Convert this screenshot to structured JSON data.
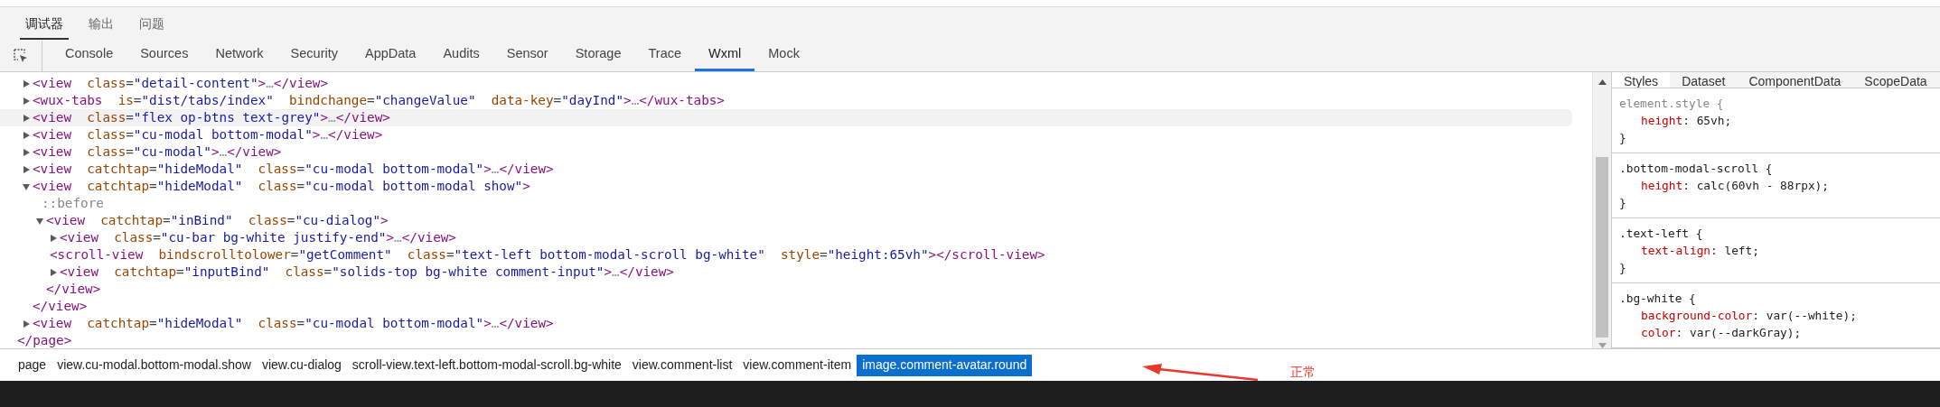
{
  "panel_tabs": [
    {
      "label": "调试器",
      "selected": true
    },
    {
      "label": "输出",
      "selected": false
    },
    {
      "label": "问题",
      "selected": false
    }
  ],
  "tool_tabs": [
    {
      "label": "Console",
      "selected": false
    },
    {
      "label": "Sources",
      "selected": false
    },
    {
      "label": "Network",
      "selected": false
    },
    {
      "label": "Security",
      "selected": false
    },
    {
      "label": "AppData",
      "selected": false
    },
    {
      "label": "Audits",
      "selected": false
    },
    {
      "label": "Sensor",
      "selected": false
    },
    {
      "label": "Storage",
      "selected": false
    },
    {
      "label": "Trace",
      "selected": false
    },
    {
      "label": "Wxml",
      "selected": true
    },
    {
      "label": "Mock",
      "selected": false
    }
  ],
  "tree": {
    "nodes": [
      {
        "kind": "element",
        "expanded": false,
        "highlighted": false,
        "open": "<view",
        "attrs": [
          "class=\"detail-content\""
        ],
        "close": ">",
        "collapsed_text": "…",
        "end": "</view>"
      },
      {
        "kind": "element",
        "expanded": false,
        "highlighted": false,
        "open": "<wux-tabs",
        "attrs": [
          "is=\"dist/tabs/index\"",
          "bindchange=\"changeValue\"",
          "data-key=\"dayInd\""
        ],
        "close": ">",
        "collapsed_text": "…",
        "end": "</wux-tabs>"
      },
      {
        "kind": "element",
        "expanded": false,
        "highlighted": true,
        "open": "<view",
        "attrs": [
          "class=\"flex op-btns text-grey\""
        ],
        "close": ">",
        "collapsed_text": "…",
        "end": "</view>"
      },
      {
        "kind": "element",
        "expanded": false,
        "highlighted": false,
        "open": "<view",
        "attrs": [
          "class=\"cu-modal bottom-modal\""
        ],
        "close": ">",
        "collapsed_text": "…",
        "end": "</view>"
      },
      {
        "kind": "element",
        "expanded": false,
        "highlighted": false,
        "open": "<view",
        "attrs": [
          "class=\"cu-modal\""
        ],
        "close": ">",
        "collapsed_text": "…",
        "end": "</view>"
      },
      {
        "kind": "element",
        "expanded": false,
        "highlighted": false,
        "open": "<view",
        "attrs": [
          "catchtap=\"hideModal\"",
          "class=\"cu-modal bottom-modal\""
        ],
        "close": ">",
        "collapsed_text": "…",
        "end": "</view>"
      },
      {
        "kind": "element",
        "expanded": true,
        "highlighted": false,
        "open": "<view",
        "attrs": [
          "catchtap=\"hideModal\"",
          "class=\"cu-modal bottom-modal show\""
        ],
        "close": ">",
        "end": "</view>",
        "children": [
          {
            "kind": "pseudo",
            "highlighted": false,
            "text": "::before"
          },
          {
            "kind": "element",
            "expanded": true,
            "highlighted": false,
            "open": "<view",
            "attrs": [
              "catchtap=\"inBind\"",
              "class=\"cu-dialog\""
            ],
            "close": ">",
            "end": "</view>",
            "children": [
              {
                "kind": "element",
                "expanded": false,
                "highlighted": false,
                "open": "<view",
                "attrs": [
                  "class=\"cu-bar bg-white justify-end\""
                ],
                "close": ">",
                "collapsed_text": "…",
                "end": "</view>"
              },
              {
                "kind": "leaf",
                "highlighted": false,
                "open": "<scroll-view",
                "attrs": [
                  "bindscrolltolower=\"getComment\"",
                  "class=\"text-left bottom-modal-scroll bg-white\"",
                  "style=\"height:65vh\""
                ],
                "close": ">",
                "end": "</scroll-view>"
              },
              {
                "kind": "element",
                "expanded": false,
                "highlighted": false,
                "open": "<view",
                "attrs": [
                  "catchtap=\"inputBind\"",
                  "class=\"solids-top bg-white comment-input\""
                ],
                "close": ">",
                "collapsed_text": "…",
                "end": "</view>"
              }
            ]
          }
        ]
      },
      {
        "kind": "element",
        "expanded": false,
        "highlighted": false,
        "open": "<view",
        "attrs": [
          "catchtap=\"hideModal\"",
          "class=\"cu-modal bottom-modal\""
        ],
        "close": ">",
        "collapsed_text": "…",
        "end": "</view>"
      }
    ],
    "closing_tag": "</page>"
  },
  "style_tabs": [
    {
      "label": "Styles",
      "selected": true
    },
    {
      "label": "Dataset",
      "selected": false
    },
    {
      "label": "ComponentData",
      "selected": false
    },
    {
      "label": "ScopeData",
      "selected": false
    }
  ],
  "style_rules": [
    {
      "kind": "inline",
      "selector": "element.style {",
      "properties": [
        "height: 65vh;"
      ],
      "close": "}"
    },
    {
      "kind": "class",
      "selector": ".bottom-modal-scroll {",
      "properties": [
        "height: calc(60vh - 88rpx);"
      ],
      "close": "}"
    },
    {
      "kind": "class",
      "selector": ".text-left {",
      "properties": [
        "text-align: left;"
      ],
      "close": "}"
    },
    {
      "kind": "class",
      "selector": ".bg-white {",
      "properties": [
        "background-color: var(--white);",
        "color: var(--darkGray);"
      ]
    }
  ],
  "breadcrumbs": [
    {
      "label": "page",
      "selected": false
    },
    {
      "label": "view.cu-modal.bottom-modal.show",
      "selected": false
    },
    {
      "label": "view.cu-dialog",
      "selected": false
    },
    {
      "label": "scroll-view.text-left.bottom-modal-scroll.bg-white",
      "selected": false
    },
    {
      "label": "view.comment-list",
      "selected": false
    },
    {
      "label": "view.comment-item",
      "selected": false
    },
    {
      "label": "image.comment-avatar.round",
      "selected": true
    }
  ],
  "annotation": {
    "text": "正常"
  }
}
